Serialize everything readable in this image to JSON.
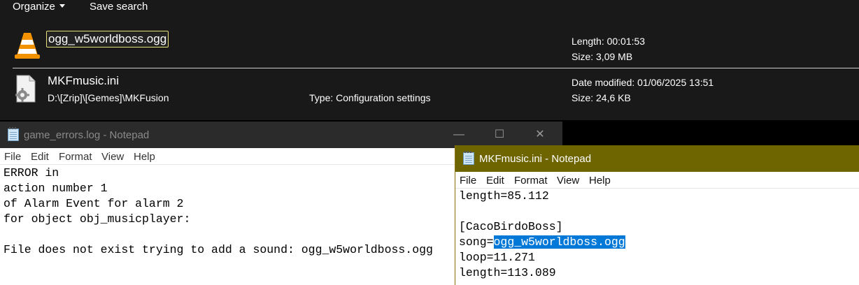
{
  "explorer": {
    "toolbar": {
      "organize_label": "Organize",
      "save_search_label": "Save search"
    },
    "results": [
      {
        "name": "ogg_w5worldboss.ogg",
        "icon": "vlc-cone-icon",
        "length": "Length: 00:01:53",
        "size": "Size: 3,09 MB"
      },
      {
        "name": "MKFmusic.ini",
        "icon": "config-file-icon",
        "path": "D:\\[Zrip]\\[Gemes]\\MKFusion",
        "type": "Type: Configuration settings",
        "date_modified": "Date modified: 01/06/2025 13:51",
        "size": "Size: 24,6 KB"
      }
    ]
  },
  "notepad_errors": {
    "title": "game_errors.log - Notepad",
    "menu": [
      "File",
      "Edit",
      "Format",
      "View",
      "Help"
    ],
    "lines": [
      "ERROR in",
      "action number 1",
      "of Alarm Event for alarm 2",
      "for object obj_musicplayer:",
      "",
      "File does not exist trying to add a sound: ogg_w5worldboss.ogg"
    ]
  },
  "notepad_ini": {
    "title": "MKFmusic.ini - Notepad",
    "menu": [
      "File",
      "Edit",
      "Format",
      "View",
      "Help"
    ],
    "lines": {
      "l0": "length=85.112",
      "l1": "",
      "l2": "[CacoBirdoBoss]",
      "l3_prefix": "song=",
      "l3_selected": "ogg_w5worldboss.ogg",
      "l4": "loop=11.271",
      "l5": "length=113.089"
    }
  },
  "colors": {
    "explorer_bg": "#191919",
    "active_titlebar": "#6f6500",
    "selection": "#0078d7",
    "rename_border": "#e6e079"
  }
}
